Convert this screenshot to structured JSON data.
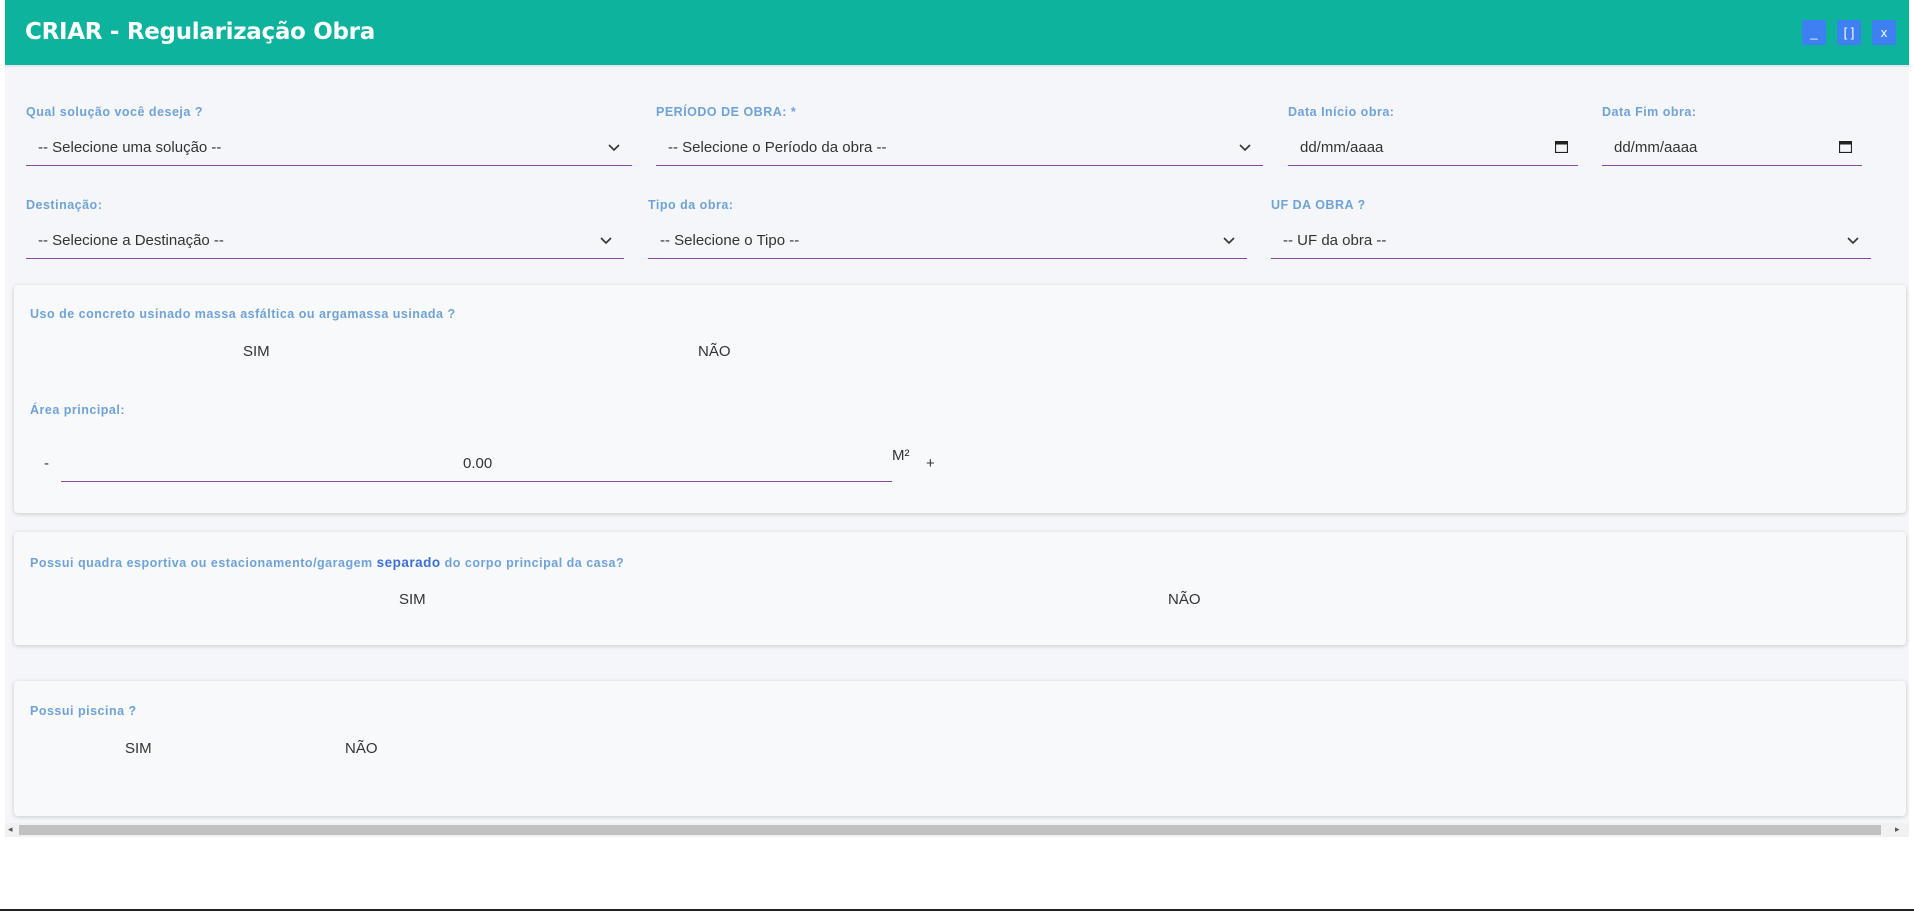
{
  "window": {
    "title": "CRIAR - Regularização Obra",
    "controls": {
      "minimize": "_",
      "maximize": "[ ]",
      "close": "x"
    }
  },
  "row1": {
    "solucao": {
      "label": "Qual solução você deseja ?",
      "value": "-- Selecione uma solução --"
    },
    "periodo": {
      "label": "PERÍODO DE OBRA: *",
      "value": "-- Selecione o Período da obra --"
    },
    "data_inicio": {
      "label": "Data Início obra:",
      "value": "dd/mm/aaaa"
    },
    "data_fim": {
      "label": "Data Fim obra:",
      "value": "dd/mm/aaaa"
    }
  },
  "row2": {
    "destinacao": {
      "label": "Destinação:",
      "value": "-- Selecione a Destinação --"
    },
    "tipo": {
      "label": "Tipo da obra:",
      "value": "-- Selecione o Tipo --"
    },
    "uf": {
      "label": "UF DA OBRA ?",
      "value": "-- UF da obra --"
    }
  },
  "concreto": {
    "question": "Uso de concreto usinado massa asfáltica ou argamassa usinada ?",
    "sim": "SIM",
    "nao": "NÃO",
    "area_label": "Área principal:",
    "minus": "-",
    "area_value": "0.00",
    "unit": "M²",
    "plus": "+"
  },
  "quadra": {
    "question_part1": "Possui quadra esportiva ou estacionamento/garagem ",
    "question_bold": "separado",
    "question_part2": " do corpo principal da casa?",
    "sim": "SIM",
    "nao": "NÃO"
  },
  "piscina": {
    "question": "Possui piscina ?",
    "sim": "SIM",
    "nao": "NÃO"
  },
  "colors": {
    "header": "#0db39c",
    "label": "#6fa3d8",
    "underline": "#8a4b9e",
    "window_button": "#3e7ff2"
  },
  "icons": [
    "chevron-down-icon",
    "calendar-icon",
    "scroll-left-icon",
    "scroll-right-icon"
  ]
}
